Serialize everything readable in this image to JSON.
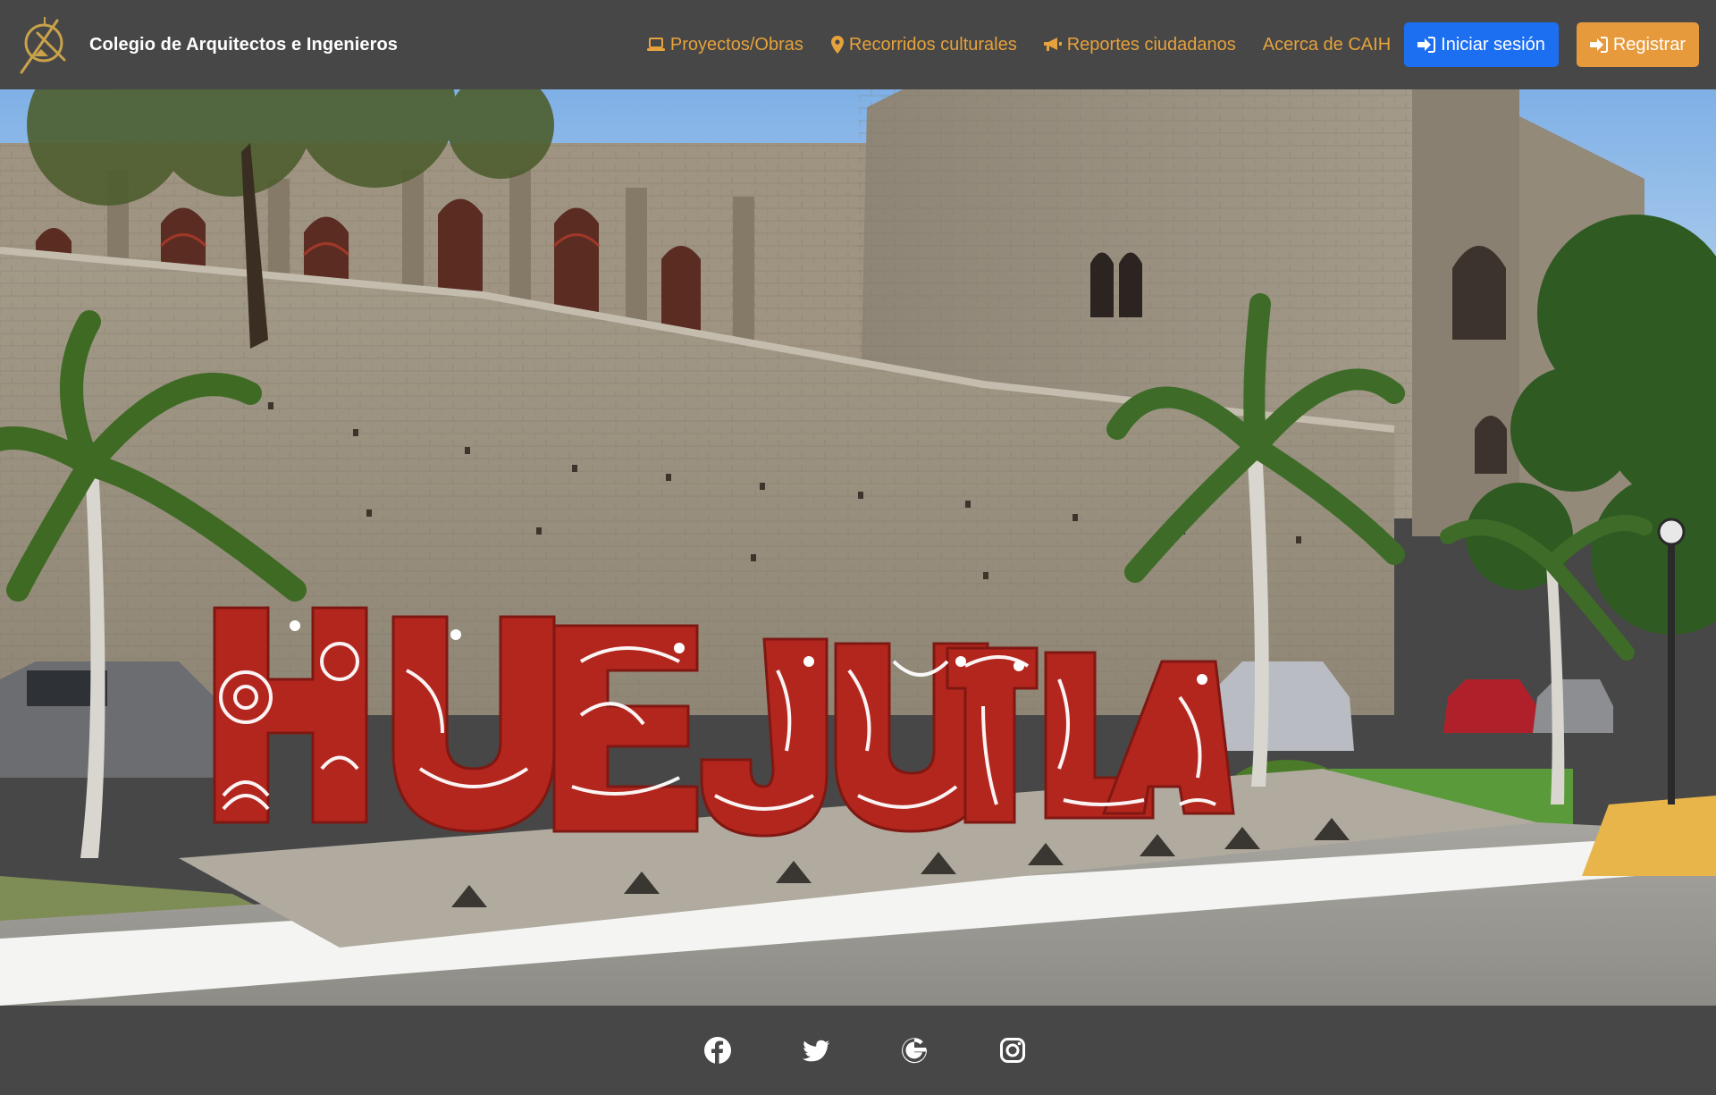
{
  "brand": {
    "name": "Colegio de Arquitectos e Ingenieros",
    "logo_icon": "compass-logo-icon"
  },
  "nav": {
    "projects": {
      "label": "Proyectos/Obras",
      "icon": "laptop-icon"
    },
    "tours": {
      "label": "Recorridos culturales",
      "icon": "map-marker-icon"
    },
    "reports": {
      "label": "Reportes ciudadanos",
      "icon": "megaphone-icon"
    },
    "about": {
      "label": "Acerca de CAIH"
    },
    "login": {
      "label": "Iniciar sesión",
      "icon": "sign-in-icon"
    },
    "register": {
      "label": "Registrar",
      "icon": "sign-in-icon"
    }
  },
  "hero": {
    "sign_text": "HUEJUTLA"
  },
  "footer": {
    "social": [
      "facebook-icon",
      "twitter-icon",
      "google-icon",
      "instagram-icon"
    ]
  },
  "colors": {
    "navbar_bg": "#474747",
    "link": "#e6a23c",
    "login_button": "#1d6ff2",
    "register_button": "#e69a3c",
    "sign_red": "#b3261e"
  }
}
